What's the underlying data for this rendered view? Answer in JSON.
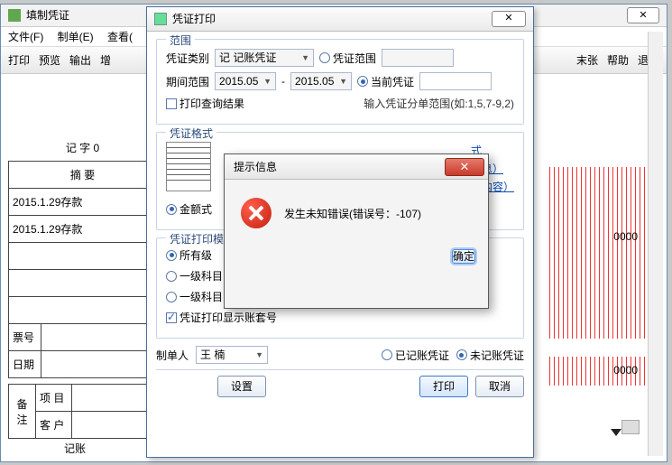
{
  "main": {
    "title": "填制凭证",
    "menus": [
      "文件(F)",
      "制单(E)",
      "查看("
    ],
    "toolbar_left": [
      "打印",
      "预览",
      "输出",
      "增"
    ],
    "toolbar_right": [
      "末张",
      "帮助",
      "退出"
    ],
    "voucher_word": "记   字    0",
    "summary_header": "摘  要",
    "rows": [
      "2015.1.29存款",
      "2015.1.29存款"
    ],
    "ticket_lbl": "票号",
    "date_lbl": "日期",
    "note_lbl": "备注",
    "proj_lbl": "项  目",
    "cust_lbl": "客  户",
    "footer": "记账",
    "right_zeros": "0000"
  },
  "print": {
    "title": "凭证打印",
    "grp_range": "范围",
    "type_lbl": "凭证类别",
    "type_val": "记 记账凭证",
    "range_radio": "凭证范围",
    "period_lbl": "期间范围",
    "period_from": "2015.05",
    "period_to": "2015.05",
    "current_radio": "当前凭证",
    "query_chk": "打印查询结果",
    "split_hint": "输入凭证分单范围(如:1,5,7-9,2)",
    "grp_fmt": "凭证格式",
    "amount_radio": "金额式",
    "link1": "式",
    "link2": "信息）",
    "link3": "要内容）",
    "grp_tpl": "凭证打印模",
    "all_radio": "所有级",
    "r2": "一级科目 - 辅助核算",
    "r3": "一级科目 - 末级科目 - 辅助核算",
    "r4": "一级科目 - 明细科目",
    "show_chk": "凭证打印显示账套号",
    "maker_lbl": "制单人",
    "maker_val": "王  楠",
    "posted": "已记账凭证",
    "unposted": "未记账凭证",
    "btn_set": "设置",
    "btn_print": "打印",
    "btn_cancel": "取消"
  },
  "err": {
    "title": "提示信息",
    "msg": "发生未知错误(错误号：-107)",
    "ok": "确定"
  }
}
